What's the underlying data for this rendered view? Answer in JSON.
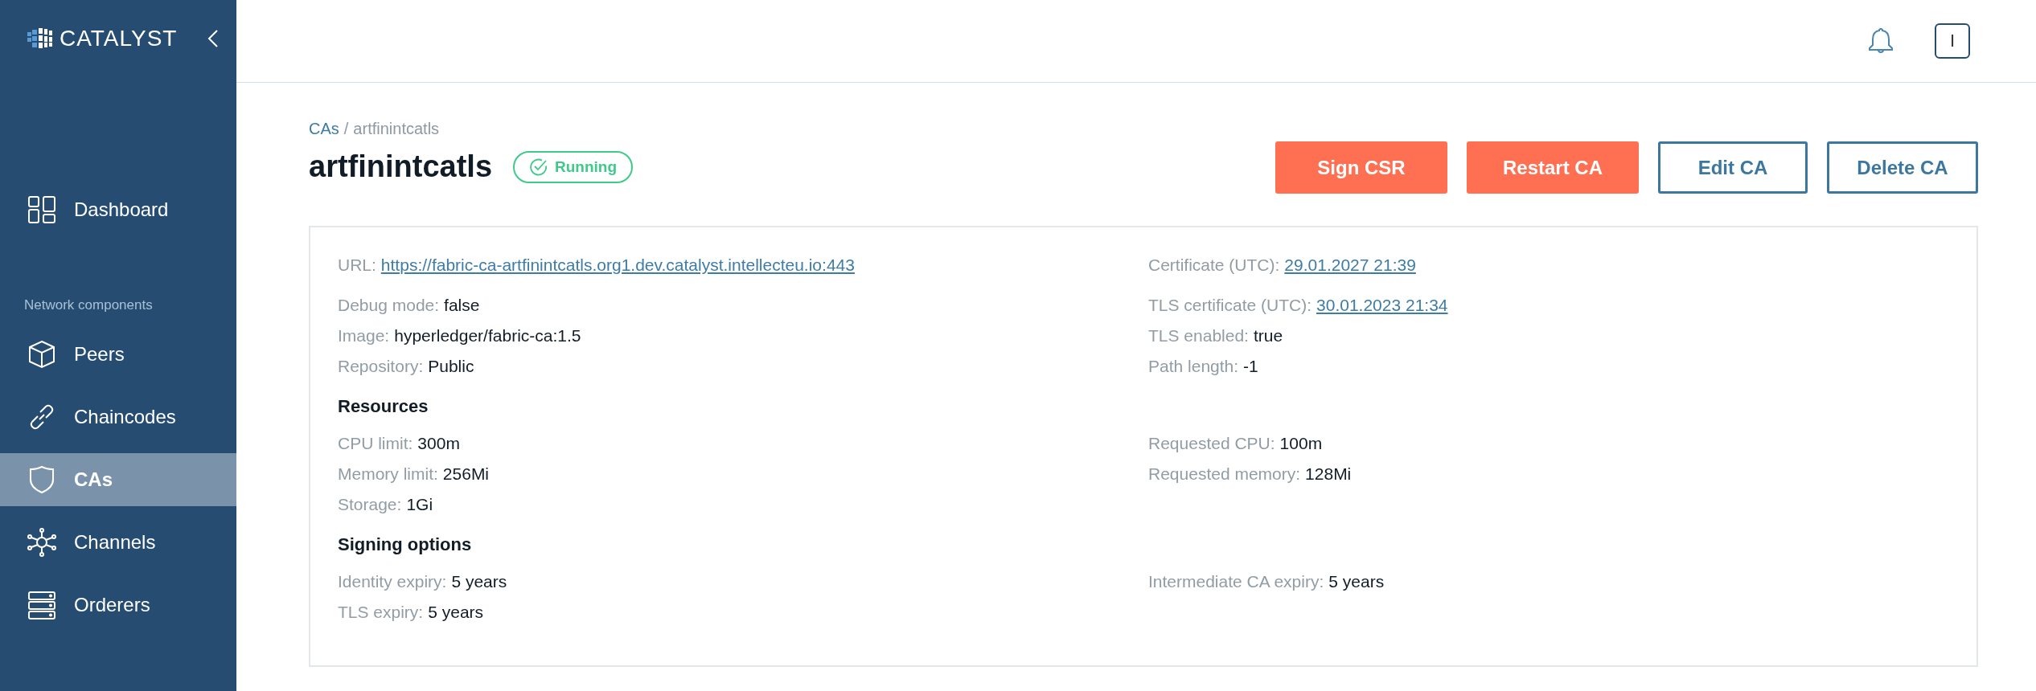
{
  "sidebar": {
    "logo": "CATALYST",
    "nav_top": [
      {
        "label": "Dashboard",
        "kind": "dashboard",
        "selected": false
      }
    ],
    "section_label": "Network components",
    "items": [
      {
        "label": "Peers",
        "kind": "peers",
        "selected": false
      },
      {
        "label": "Chaincodes",
        "kind": "chaincodes",
        "selected": false
      },
      {
        "label": "CAs",
        "kind": "cas",
        "selected": true
      },
      {
        "label": "Channels",
        "kind": "channels",
        "selected": false
      },
      {
        "label": "Orderers",
        "kind": "orderers",
        "selected": false
      }
    ]
  },
  "topbar": {
    "avatar": "I"
  },
  "breadcrumb": {
    "parent": "CAs",
    "separator": "/",
    "current": "artfinintcatls"
  },
  "title": "artfinintcatls",
  "status": "Running",
  "buttons": [
    {
      "label": "Sign CSR",
      "kind": "primary"
    },
    {
      "label": "Restart CA",
      "kind": "primary"
    },
    {
      "label": "Edit CA",
      "kind": "outline"
    },
    {
      "label": "Delete CA",
      "kind": "outline"
    }
  ],
  "sections": [
    {
      "rows": [
        {
          "left": {
            "label": "URL:",
            "value": "https://fabric-ca-artfinintcatls.org1.dev.catalyst.intellecteu.io:443",
            "kind": "link"
          },
          "right": {
            "label": "Certificate (UTC):",
            "value": "29.01.2027 21:39",
            "kind": "link"
          }
        }
      ]
    },
    {
      "rows": [
        {
          "left": {
            "label": "Debug mode:",
            "value": "false",
            "kind": "text"
          },
          "right": {
            "label": "TLS certificate (UTC):",
            "value": "30.01.2023 21:34",
            "kind": "link"
          }
        },
        {
          "left": {
            "label": "Image:",
            "value": "hyperledger/fabric-ca:1.5",
            "kind": "text"
          },
          "right": {
            "label": "TLS enabled:",
            "value": "true",
            "kind": "text"
          }
        },
        {
          "left": {
            "label": "Repository:",
            "value": "Public",
            "kind": "text"
          },
          "right": {
            "label": "Path length:",
            "value": "-1",
            "kind": "text"
          }
        }
      ]
    },
    {
      "heading": "Resources",
      "rows": [
        {
          "left": {
            "label": "CPU limit:",
            "value": "300m",
            "kind": "text"
          },
          "right": {
            "label": "Requested CPU:",
            "value": "100m",
            "kind": "text"
          }
        },
        {
          "left": {
            "label": "Memory limit:",
            "value": "256Mi",
            "kind": "text"
          },
          "right": {
            "label": "Requested memory:",
            "value": "128Mi",
            "kind": "text"
          }
        },
        {
          "left": {
            "label": "Storage:",
            "value": "1Gi",
            "kind": "text"
          }
        }
      ]
    },
    {
      "heading": "Signing options",
      "rows": [
        {
          "left": {
            "label": "Identity expiry:",
            "value": "5 years",
            "kind": "text"
          },
          "right": {
            "label": "Intermediate CA expiry:",
            "value": "5 years",
            "kind": "text"
          }
        },
        {
          "left": {
            "label": "TLS expiry:",
            "value": "5 years",
            "kind": "text"
          }
        }
      ]
    }
  ]
}
